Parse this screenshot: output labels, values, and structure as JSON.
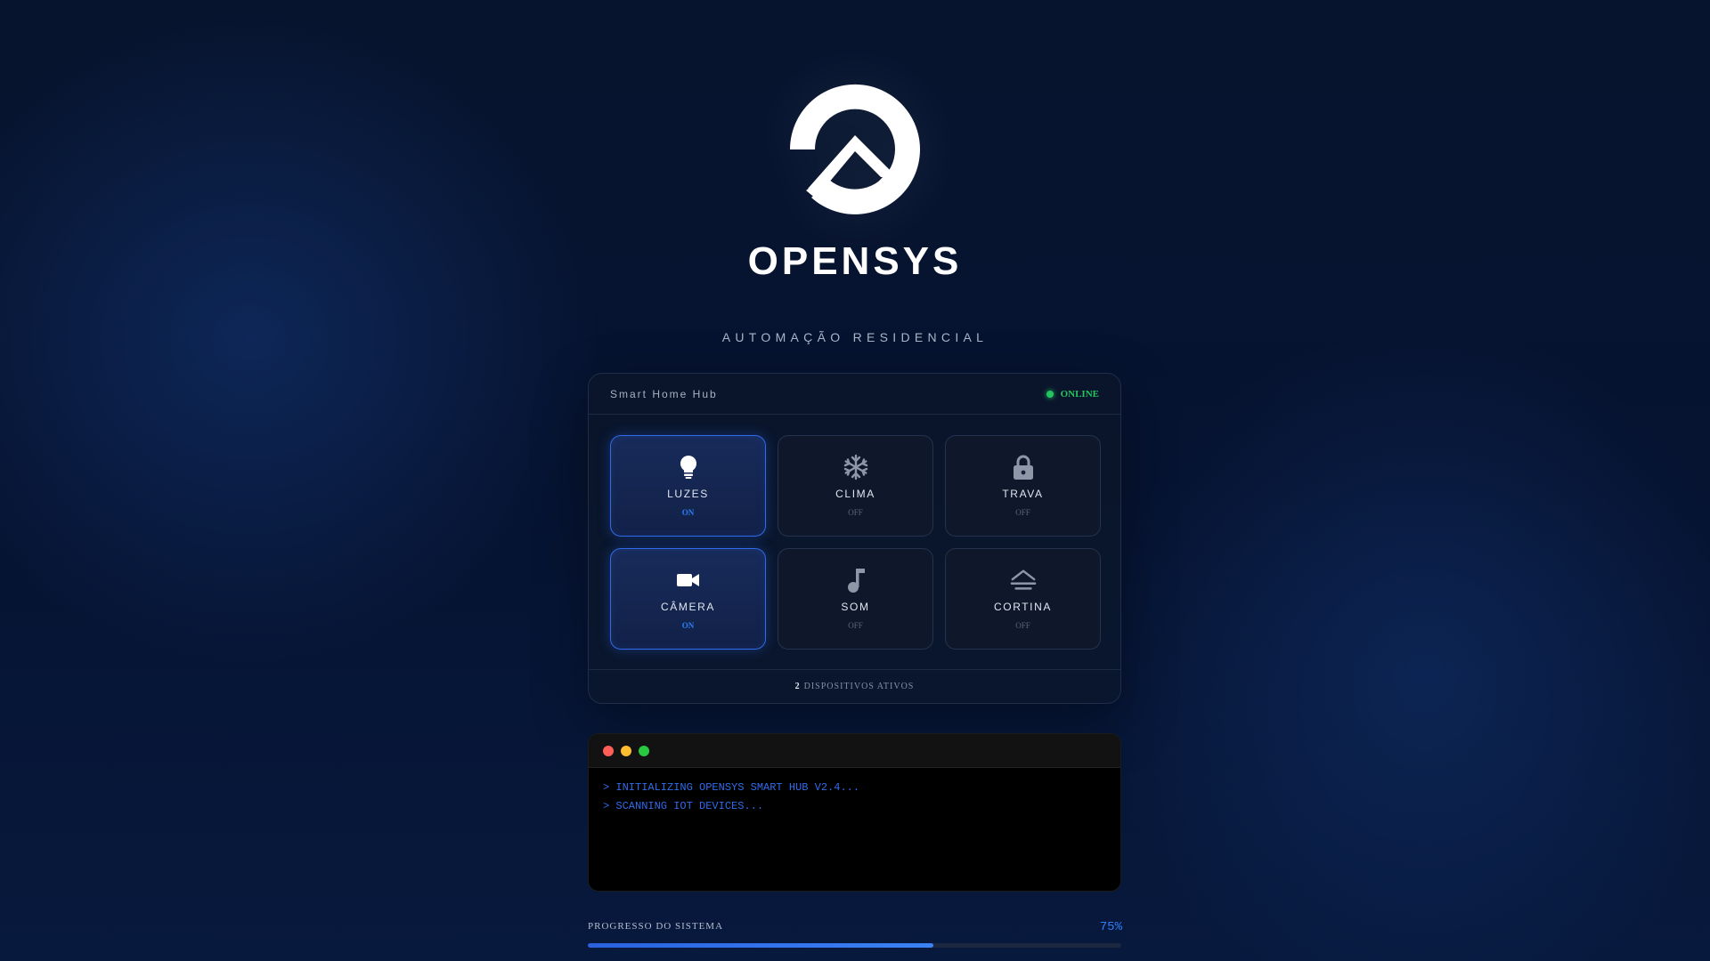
{
  "brand": {
    "name": "OPENSYS",
    "subtitle": "AUTOMAÇÃO RESIDENCIAL"
  },
  "hub": {
    "title": "Smart Home Hub",
    "status": "ONLINE",
    "devices": [
      {
        "label": "LUZES",
        "state": "ON",
        "icon": "lightbulb-icon"
      },
      {
        "label": "CLIMA",
        "state": "OFF",
        "icon": "snowflake-icon"
      },
      {
        "label": "TRAVA",
        "state": "OFF",
        "icon": "lock-icon"
      },
      {
        "label": "CÂMERA",
        "state": "ON",
        "icon": "video-camera-icon"
      },
      {
        "label": "SOM",
        "state": "OFF",
        "icon": "music-note-icon"
      },
      {
        "label": "CORTINA",
        "state": "OFF",
        "icon": "curtain-icon"
      }
    ],
    "footer_count": "2",
    "footer_text": "DISPOSITIVOS ATIVOS"
  },
  "terminal": {
    "lines": [
      "> INITIALIZING OPENSYS SMART HUB V2.4...",
      "> SCANNING IOT DEVICES..."
    ]
  },
  "progress": {
    "label": "PROGRESSO DO SISTEMA",
    "percent_text": "75%",
    "fill_fraction": 0.647
  },
  "colors": {
    "accent": "#2f7df6",
    "online": "#22c55e",
    "dot_red": "#ff5f57",
    "dot_yellow": "#febc2e",
    "dot_green": "#28c840"
  }
}
